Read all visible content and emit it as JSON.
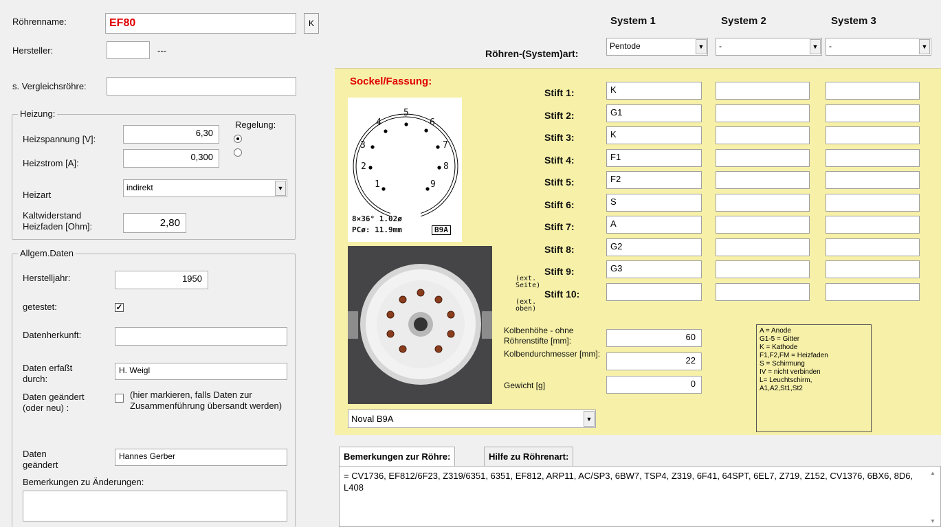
{
  "left": {
    "tube_name_label": "Röhrenname:",
    "tube_name_value": "EF80",
    "k_button": "K",
    "manufacturer_label": "Hersteller:",
    "manufacturer_value": "",
    "manufacturer_suffix": "---",
    "comparison_label": "s. Vergleichsröhre:",
    "comparison_value": "",
    "heating": {
      "title": "Heizung:",
      "voltage_label": "Heizspannung [V]:",
      "voltage_value": "6,30",
      "current_label": "Heizstrom [A]:",
      "current_value": "0,300",
      "regulation_label": "Regelung:",
      "type_label": "Heizart",
      "type_value": "indirekt",
      "cold_resistance_label": "Kaltwiderstand Heizfaden [Ohm]:",
      "cold_resistance_value": "2,80"
    },
    "general": {
      "title": "Allgem.Daten",
      "year_label": "Herstelljahr:",
      "year_value": "1950",
      "tested_label": "getestet:",
      "tested_mark": "✓",
      "origin_label": "Datenherkunft:",
      "origin_value": "",
      "recorded_by_label": "Daten erfaßt durch:",
      "recorded_by_value": "H. Weigl",
      "changed_label": "Daten geändert (oder neu) :",
      "changed_hint": "(hier markieren, falls Daten zur Zusammenführung übersandt werden)",
      "changed_by_label": "Daten geändert",
      "changed_by_value": "Hannes Gerber",
      "change_remarks_label": "Bemerkungen zu Änderungen:",
      "change_remarks_value": ""
    }
  },
  "systems": {
    "headers": [
      "System 1",
      "System 2",
      "System 3"
    ],
    "type_label": "Röhren-(System)art:",
    "types": [
      "Pentode",
      "-",
      "-"
    ]
  },
  "socket": {
    "title": "Sockel/Fassung:",
    "diagram": {
      "pin_numbers": [
        "1",
        "2",
        "3",
        "4",
        "5",
        "6",
        "7",
        "8",
        "9"
      ],
      "spec_line1": "8×36° 1.02ø",
      "spec_line2": "PCø: 11.9mm",
      "code": "B9A"
    },
    "pin_labels": [
      "Stift 1:",
      "Stift 2:",
      "Stift 3:",
      "Stift 4:",
      "Stift 5:",
      "Stift 6:",
      "Stift 7:",
      "Stift 8:",
      "Stift 9:",
      "Stift 10:"
    ],
    "ext_side": [
      "(ext.",
      "Seite)"
    ],
    "ext_top": [
      "(ext.",
      "oben)"
    ],
    "pins_system1": [
      "K",
      "G1",
      "K",
      "F1",
      "F2",
      "S",
      "A",
      "G2",
      "G3",
      ""
    ],
    "bulb_height_label": "Kolbenhöhe - ohne Röhrenstifte [mm]:",
    "bulb_height_value": "60",
    "bulb_diameter_label": "Kolbendurchmesser [mm]:",
    "bulb_diameter_value": "22",
    "weight_label": "Gewicht [g]",
    "weight_value": "0",
    "socket_type": "Noval B9A",
    "legend": [
      "A = Anode",
      "G1-5 = Gitter",
      "K = Kathode",
      "F1,F2,FM = Heizfaden",
      "S = Schirmung",
      "IV = nicht verbinden",
      "L= Leuchtschirm,",
      "A1,A2,St1,St2"
    ]
  },
  "tabs": [
    "Bemerkungen zur Röhre:",
    "Hilfe zu Röhrenart:"
  ],
  "remarks": "= CV1736,  EF812/6F23,  Z319/6351,  6351,  EF812,  ARP11,  AC/SP3,  6BW7,  TSP4,  Z319,  6F41,  64SPT,  6EL7,  Z719,  Z152,  CV1376,  6BX6, 8D6, L408",
  "colors": {
    "name_red": "#e00000",
    "panel_yellow": "#f6f0a8",
    "socket_title_red": "#e00000"
  }
}
